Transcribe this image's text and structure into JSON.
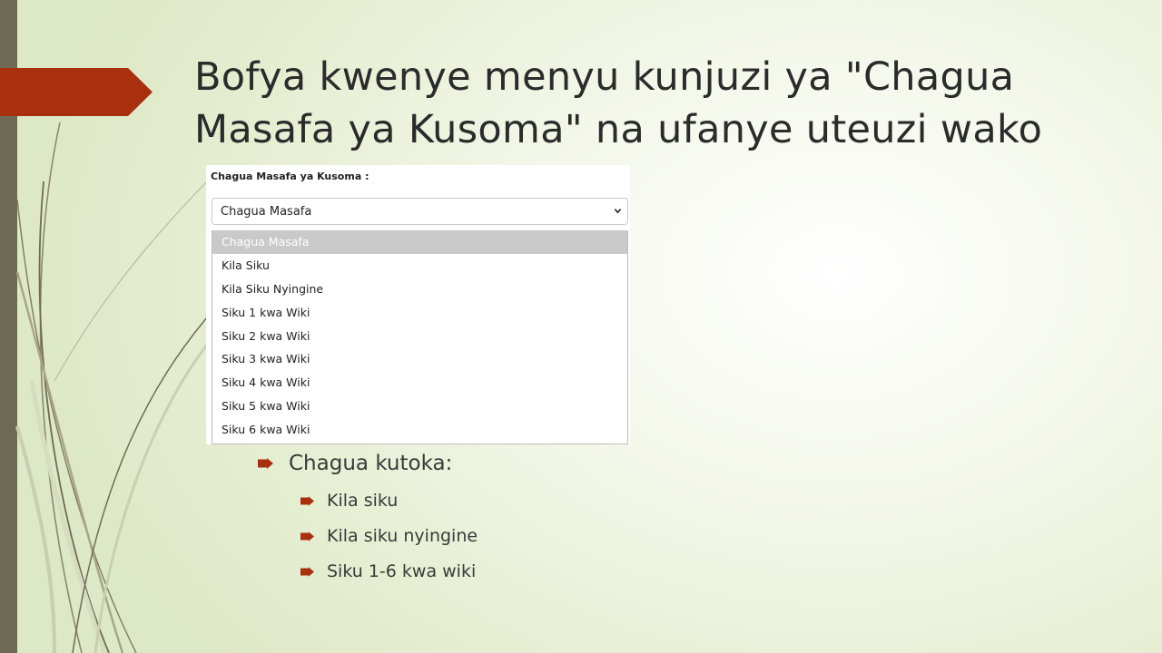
{
  "slide": {
    "title": "Bofya kwenye menyu kunjuzi ya \"Chagua Masafa ya Kusoma\" na ufanye uteuzi wako"
  },
  "screenshot": {
    "label": "Chagua Masafa ya Kusoma :",
    "select_value": "Chagua Masafa",
    "options": [
      "Chagua Masafa",
      "Kila Siku",
      "Kila Siku Nyingine",
      "Siku 1 kwa Wiki",
      "Siku 2 kwa Wiki",
      "Siku 3 kwa Wiki",
      "Siku 4 kwa Wiki",
      "Siku 5 kwa Wiki",
      "Siku 6 kwa Wiki"
    ],
    "highlighted_option": "Chagua Masafa"
  },
  "bullets": {
    "main": "Chagua kutoka:",
    "sub": [
      "Kila siku",
      "Kila siku nyingine",
      "Siku 1-6 kwa wiki"
    ]
  },
  "colors": {
    "accent_red": "#a8300f",
    "side_bar": "#6f6a55",
    "highlight_gray": "#c9c9c9"
  },
  "icons": {
    "bullet": "arrow-bullet-icon",
    "select_arrow": "chevron-down-icon"
  }
}
